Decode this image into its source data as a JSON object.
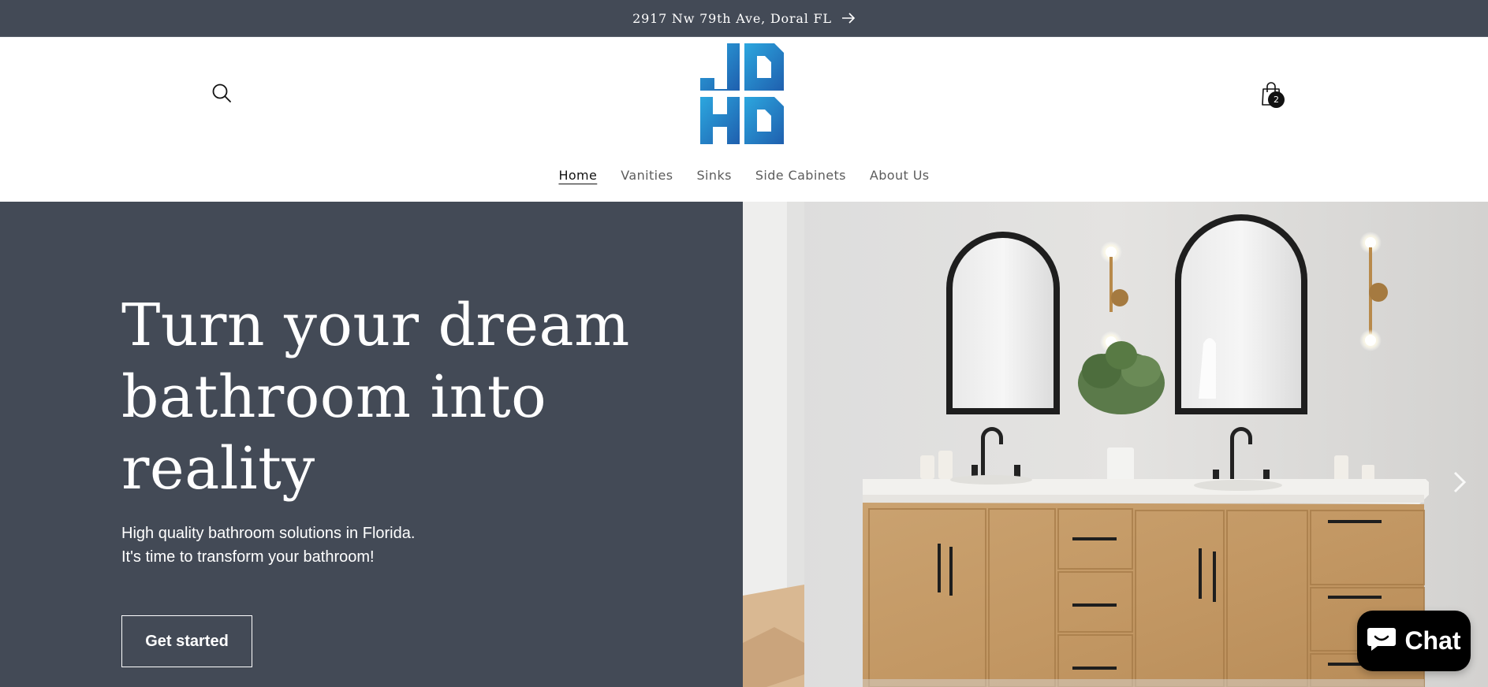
{
  "announcement": {
    "text": "2917 Nw 79th Ave, Doral FL",
    "arrow_icon": "arrow-right-icon"
  },
  "header": {
    "logo_text": "JDHD",
    "cart_count": "2",
    "icons": {
      "search": "search-icon",
      "cart": "shopping-bag-icon"
    }
  },
  "nav": {
    "items": [
      {
        "label": "Home",
        "active": true
      },
      {
        "label": "Vanities",
        "active": false
      },
      {
        "label": "Sinks",
        "active": false
      },
      {
        "label": "Side Cabinets",
        "active": false
      },
      {
        "label": "About Us",
        "active": false
      }
    ]
  },
  "hero": {
    "title": "Turn your dream bathroom into reality",
    "subtitle_lines": [
      "High quality bathroom solutions in Florida.",
      "It's time to transform your bathroom!"
    ],
    "button_label": "Get started",
    "next_icon": "chevron-right-icon"
  },
  "chat": {
    "label": "Chat",
    "icon": "chat-bubble-icon"
  },
  "colors": {
    "dark_slate": "#434a56",
    "logo_blue_light": "#2ca7df",
    "logo_blue_dark": "#1f5fae",
    "wood": "#c8a06e",
    "chat_bg": "#000000"
  }
}
